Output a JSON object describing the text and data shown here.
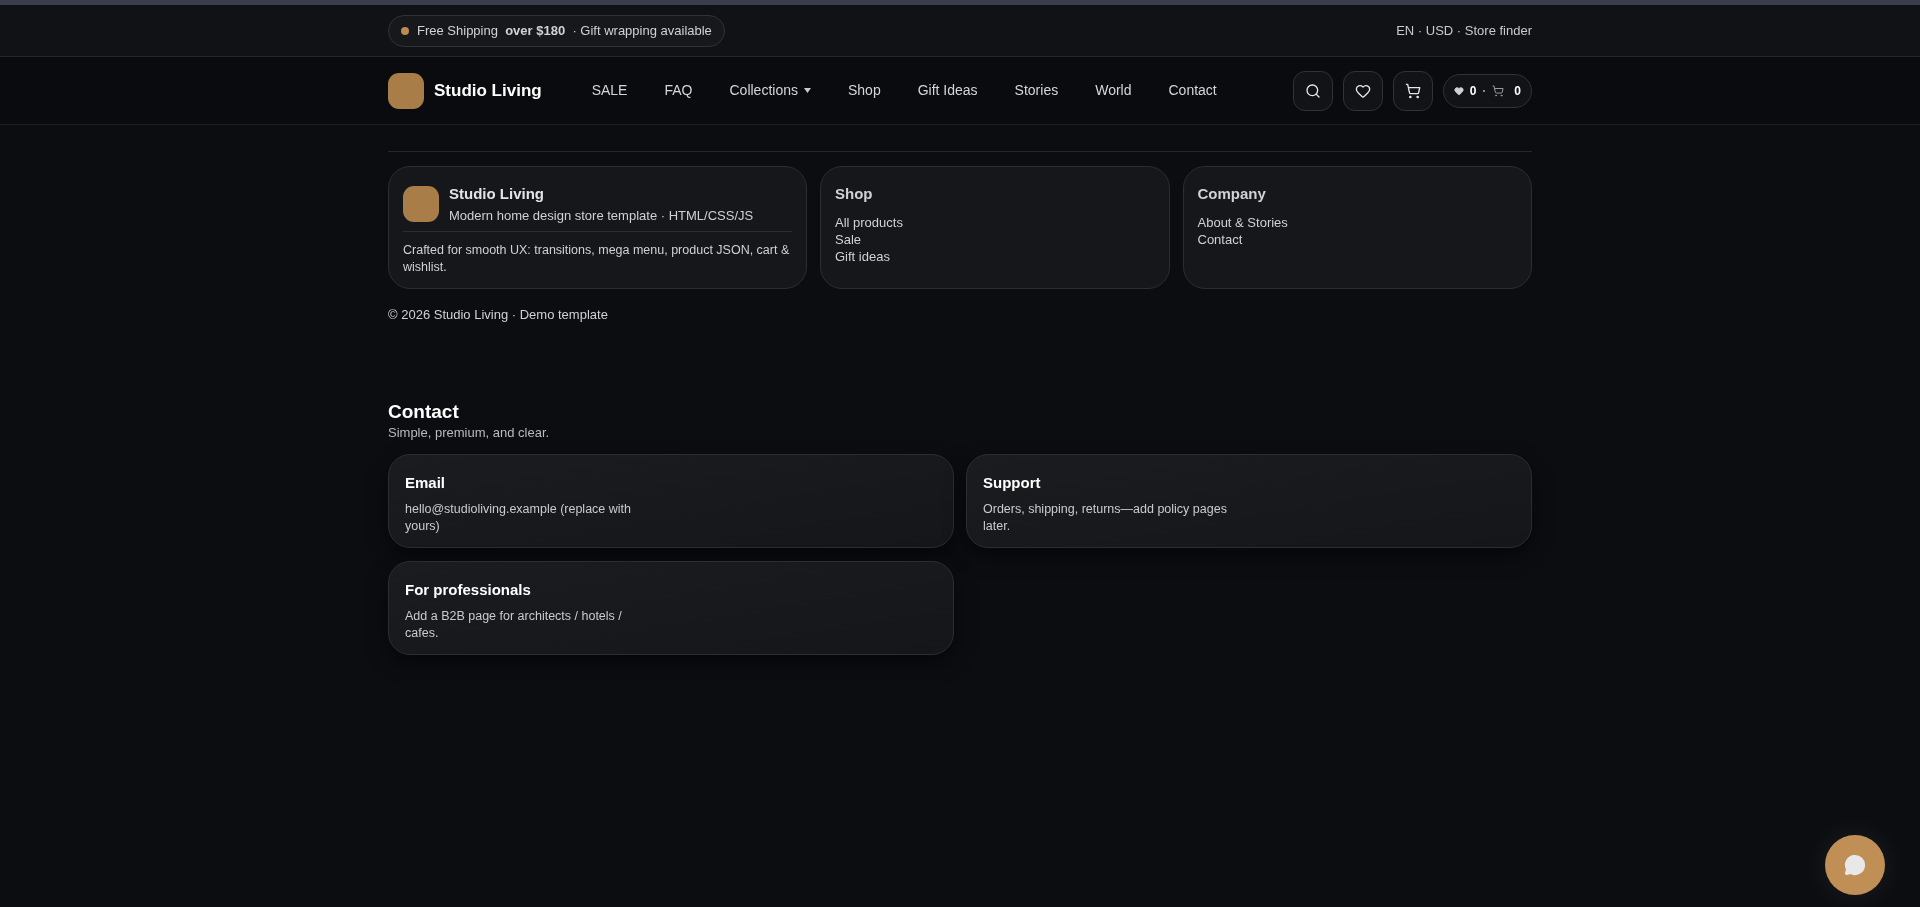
{
  "promo_bar": {
    "text": "Free Shipping  **over $180**  · Gift wrapping available",
    "locale_links": "EN · USD · Store finder"
  },
  "header": {
    "brand": "Studio Living",
    "nav": [
      {
        "label": "SALE",
        "dropdown": false
      },
      {
        "label": "FAQ",
        "dropdown": false
      },
      {
        "label": "Collections",
        "dropdown": true
      },
      {
        "label": "Shop",
        "dropdown": false
      },
      {
        "label": "Gift Ideas",
        "dropdown": false
      },
      {
        "label": "Stories",
        "dropdown": false
      },
      {
        "label": "World",
        "dropdown": false
      },
      {
        "label": "Contact",
        "dropdown": false
      }
    ],
    "counter": {
      "wishlist": "0",
      "separator": "·",
      "cart": "0"
    }
  },
  "footer": {
    "brand_card": {
      "title": "Studio Living",
      "subtitle": "Modern home design store template · HTML/CSS/JS",
      "description": "Crafted for smooth UX: transitions, mega menu, product JSON, cart & wishlist."
    },
    "link_cards": [
      {
        "title": "Shop",
        "links": [
          "All products",
          "Sale",
          "Gift ideas"
        ]
      },
      {
        "title": "Company",
        "links": [
          "About & Stories",
          "Contact"
        ]
      }
    ],
    "copyright": "© 2026 Studio Living · Demo template"
  },
  "contact": {
    "title": "Contact",
    "subtitle": "Simple, premium, and clear.",
    "cards": [
      {
        "title": "Email",
        "text": "hello@studioliving.example (replace with yours)"
      },
      {
        "title": "Support",
        "text": "Orders, shipping, returns—add policy pages later."
      },
      {
        "title": "For professionals",
        "text": "Add a B2B page for architects / hotels / cafes."
      }
    ]
  }
}
